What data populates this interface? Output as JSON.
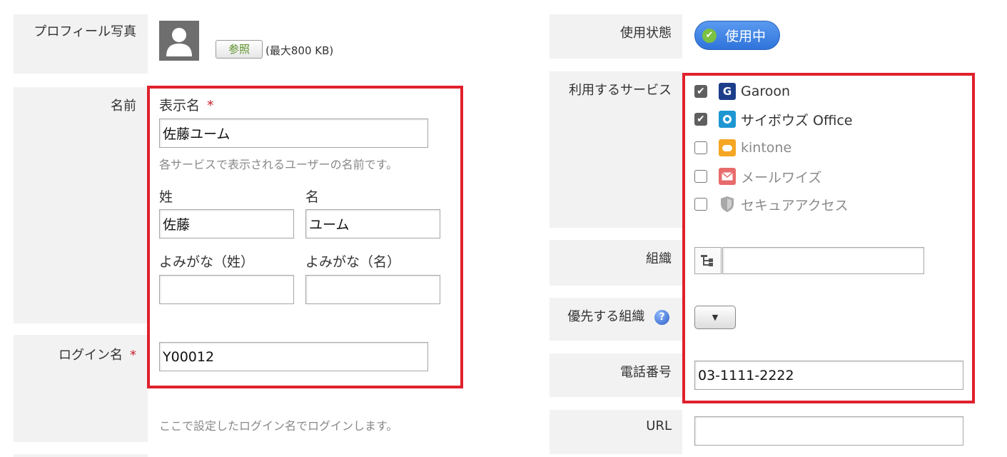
{
  "left": {
    "profile_photo": {
      "label": "プロフィール写真",
      "browse_button": "参照",
      "max_size": "(最大800 KB)"
    },
    "name": {
      "label": "名前",
      "display_name_label": "表示名",
      "required_mark": "*",
      "display_name_value": "佐藤ユーム",
      "display_name_hint": "各サービスで表示されるユーザーの名前です。",
      "last_name_label": "姓",
      "first_name_label": "名",
      "last_name_value": "佐藤",
      "first_name_value": "ユーム",
      "last_kana_label": "よみがな（姓）",
      "first_kana_label": "よみがな（名）",
      "last_kana_value": "",
      "first_kana_value": ""
    },
    "login": {
      "label": "ログイン名",
      "required_mark": "*",
      "value": "Y00012",
      "hint": "ここで設定したログイン名でログインします。"
    }
  },
  "right": {
    "status": {
      "label": "使用状態",
      "value": "使用中"
    },
    "services": {
      "label": "利用するサービス",
      "items": [
        {
          "name": "Garoon",
          "checked": true,
          "icon": "garoon-icon",
          "color": "#1c3e8a"
        },
        {
          "name": "サイボウズ Office",
          "checked": true,
          "icon": "office-icon",
          "color": "#1e96d2"
        },
        {
          "name": "kintone",
          "checked": false,
          "icon": "kintone-icon",
          "color": "#f5a623"
        },
        {
          "name": "メールワイズ",
          "checked": false,
          "icon": "mailwise-icon",
          "color": "#e05a5a"
        },
        {
          "name": "セキュアアクセス",
          "checked": false,
          "icon": "secure-access-icon",
          "color": "#9a9a9a"
        }
      ]
    },
    "organization": {
      "label": "組織",
      "value": ""
    },
    "priority_org": {
      "label": "優先する組織"
    },
    "phone": {
      "label": "電話番号",
      "value": "03-1111-2222"
    },
    "url": {
      "label": "URL",
      "value": ""
    }
  },
  "colors": {
    "highlight_border": "#e0212d",
    "label_bg": "#f2f2f2",
    "status_badge": "#3a7fe0"
  }
}
